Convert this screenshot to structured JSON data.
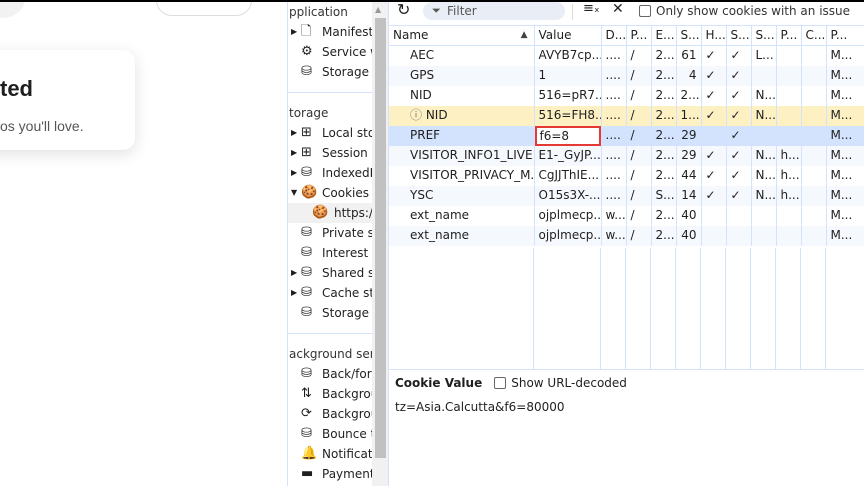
{
  "page": {
    "heading": "ted",
    "subtext": "os you'll love."
  },
  "sidebar": {
    "sections": [
      {
        "title": "pplication",
        "items": [
          {
            "label": "Manifest",
            "icon": "document-icon",
            "expand": true
          },
          {
            "label": "Service w",
            "icon": "gears-icon",
            "expand": false
          },
          {
            "label": "Storage",
            "icon": "database-icon",
            "expand": false
          }
        ]
      },
      {
        "title": "torage",
        "items": [
          {
            "label": "Local stor",
            "icon": "table-icon",
            "expand": true
          },
          {
            "label": "Session st",
            "icon": "table-icon",
            "expand": true
          },
          {
            "label": "IndexedD",
            "icon": "database-icon",
            "expand": true
          },
          {
            "label": "Cookies",
            "icon": "cookie-icon",
            "expand": true,
            "open": true
          },
          {
            "label": "https://",
            "icon": "cookie-icon",
            "selected": true
          },
          {
            "label": "Private st",
            "icon": "database-icon"
          },
          {
            "label": "Interest g",
            "icon": "database-icon"
          },
          {
            "label": "Shared st",
            "icon": "database-icon",
            "expand": true
          },
          {
            "label": "Cache sto",
            "icon": "database-icon",
            "expand": true
          },
          {
            "label": "Storage b",
            "icon": "database-icon"
          }
        ]
      },
      {
        "title": "ackground servi",
        "items": [
          {
            "label": "Back/forw",
            "icon": "database-icon"
          },
          {
            "label": "Backgrou",
            "icon": "sync-arrows-icon"
          },
          {
            "label": "Backgrou",
            "icon": "refresh-icon"
          },
          {
            "label": "Bounce tr",
            "icon": "database-icon"
          },
          {
            "label": "Notificati",
            "icon": "bell-icon"
          },
          {
            "label": "Payment",
            "icon": "card-icon"
          }
        ]
      }
    ]
  },
  "toolbar": {
    "filter_placeholder": "Filter",
    "only_issues_label": "Only show cookies with an issue"
  },
  "table": {
    "headers": [
      "Name",
      "Value",
      "D...",
      "P...",
      "E...",
      "S...",
      "H...",
      "S...",
      "S...",
      "P...",
      "C...",
      "P..."
    ],
    "rows": [
      [
        "AEC",
        "AVYB7cp...",
        "....",
        "/",
        "2...",
        "61",
        "✓",
        "✓",
        "L...",
        "",
        "",
        "M..."
      ],
      [
        "GPS",
        "1",
        "....",
        "/",
        "2...",
        "4",
        "✓",
        "✓",
        "",
        "",
        "",
        "M..."
      ],
      [
        "NID",
        "516=pR7...",
        "....",
        "/",
        "2...",
        "2...",
        "✓",
        "✓",
        "N...",
        "",
        "",
        "M..."
      ],
      [
        "NID",
        "516=FH8...",
        "....",
        "/",
        "2...",
        "1...",
        "✓",
        "✓",
        "N...",
        "",
        "",
        "M..."
      ],
      [
        "PREF",
        "f6=8",
        "....",
        "/",
        "2...",
        "29",
        "",
        "✓",
        "",
        "",
        "",
        "M..."
      ],
      [
        "VISITOR_INFO1_LIVE",
        "E1-_GyJP...",
        "....",
        "/",
        "2...",
        "29",
        "✓",
        "✓",
        "N...",
        "h...",
        "",
        "M..."
      ],
      [
        "VISITOR_PRIVACY_M...",
        "CgJJThIE...",
        "....",
        "/",
        "2...",
        "44",
        "✓",
        "✓",
        "N...",
        "h...",
        "",
        "M..."
      ],
      [
        "YSC",
        "O15s3X-...",
        "....",
        "/",
        "S...",
        "14",
        "✓",
        "✓",
        "N...",
        "h...",
        "",
        "M..."
      ],
      [
        "ext_name",
        "ojplmecp...",
        "w...",
        "/",
        "2...",
        "40",
        "",
        "",
        "",
        "",
        "",
        "M..."
      ],
      [
        "ext_name",
        "ojplmecp...",
        "w...",
        "/",
        "2...",
        "40",
        "",
        "",
        "",
        "",
        "",
        "M..."
      ]
    ]
  },
  "cookie_value": {
    "title": "Cookie Value",
    "decode_label": "Show URL-decoded",
    "value": "tz=Asia.Calcutta&f6=80000"
  }
}
